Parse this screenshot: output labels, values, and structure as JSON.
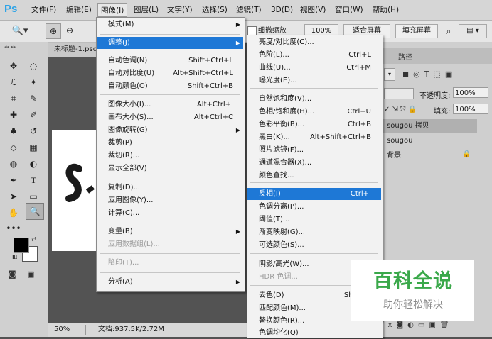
{
  "app": {
    "logo": "Ps"
  },
  "menubar": {
    "items": [
      {
        "label": "文件(F)"
      },
      {
        "label": "编辑(E)"
      },
      {
        "label": "图像(I)"
      },
      {
        "label": "图层(L)"
      },
      {
        "label": "文字(Y)"
      },
      {
        "label": "选择(S)"
      },
      {
        "label": "滤镜(T)"
      },
      {
        "label": "3D(D)"
      },
      {
        "label": "视图(V)"
      },
      {
        "label": "窗口(W)"
      },
      {
        "label": "帮助(H)"
      }
    ]
  },
  "options": {
    "fine_zoom": "细微缩放",
    "zoom_100": "100%",
    "fit_screen": "适合屏幕",
    "fill_screen": "填充屏幕"
  },
  "document": {
    "tab_title": "未标题-1.psd",
    "zoom": "50%",
    "doc_info": "文档:937.5K/2.72M"
  },
  "panels": {
    "tab_path": "路径",
    "opacity_label": "不透明度:",
    "opacity_value": "100%",
    "fill_label": "填充:",
    "fill_value": "100%",
    "layers": [
      "sougou 拷贝",
      "sougou",
      "背景"
    ]
  },
  "image_menu": {
    "items": [
      {
        "label": "模式(M)",
        "shortcut": "",
        "submenu": true
      },
      {
        "label": "调整(J)",
        "shortcut": "",
        "submenu": true,
        "highlighted": true
      },
      {
        "label": "自动色调(N)",
        "shortcut": "Shift+Ctrl+L"
      },
      {
        "label": "自动对比度(U)",
        "shortcut": "Alt+Shift+Ctrl+L"
      },
      {
        "label": "自动颜色(O)",
        "shortcut": "Shift+Ctrl+B"
      },
      {
        "label": "图像大小(I)...",
        "shortcut": "Alt+Ctrl+I"
      },
      {
        "label": "画布大小(S)...",
        "shortcut": "Alt+Ctrl+C"
      },
      {
        "label": "图像旋转(G)",
        "shortcut": "",
        "submenu": true
      },
      {
        "label": "裁剪(P)",
        "shortcut": ""
      },
      {
        "label": "裁切(R)...",
        "shortcut": ""
      },
      {
        "label": "显示全部(V)",
        "shortcut": ""
      },
      {
        "label": "复制(D)...",
        "shortcut": ""
      },
      {
        "label": "应用图像(Y)...",
        "shortcut": ""
      },
      {
        "label": "计算(C)...",
        "shortcut": ""
      },
      {
        "label": "变量(B)",
        "shortcut": "",
        "submenu": true
      },
      {
        "label": "应用数据组(L)...",
        "shortcut": "",
        "disabled": true
      },
      {
        "label": "陷印(T)...",
        "shortcut": "",
        "disabled": true
      },
      {
        "label": "分析(A)",
        "shortcut": "",
        "submenu": true
      }
    ]
  },
  "adjust_menu": {
    "items": [
      {
        "label": "亮度/对比度(C)...",
        "shortcut": ""
      },
      {
        "label": "色阶(L)...",
        "shortcut": "Ctrl+L"
      },
      {
        "label": "曲线(U)...",
        "shortcut": "Ctrl+M"
      },
      {
        "label": "曝光度(E)...",
        "shortcut": ""
      },
      {
        "label": "自然饱和度(V)...",
        "shortcut": ""
      },
      {
        "label": "色相/饱和度(H)...",
        "shortcut": "Ctrl+U"
      },
      {
        "label": "色彩平衡(B)...",
        "shortcut": "Ctrl+B"
      },
      {
        "label": "黑白(K)...",
        "shortcut": "Alt+Shift+Ctrl+B"
      },
      {
        "label": "照片滤镜(F)...",
        "shortcut": ""
      },
      {
        "label": "通道混合器(X)...",
        "shortcut": ""
      },
      {
        "label": "颜色查找...",
        "shortcut": ""
      },
      {
        "label": "反相(I)",
        "shortcut": "Ctrl+I",
        "highlighted": true
      },
      {
        "label": "色调分离(P)...",
        "shortcut": ""
      },
      {
        "label": "阈值(T)...",
        "shortcut": ""
      },
      {
        "label": "渐变映射(G)...",
        "shortcut": ""
      },
      {
        "label": "可选颜色(S)...",
        "shortcut": ""
      },
      {
        "label": "阴影/高光(W)...",
        "shortcut": ""
      },
      {
        "label": "HDR 色调...",
        "shortcut": "",
        "disabled": true
      },
      {
        "label": "去色(D)",
        "shortcut": "Shift+C"
      },
      {
        "label": "匹配颜色(M)...",
        "shortcut": ""
      },
      {
        "label": "替换颜色(R)...",
        "shortcut": ""
      },
      {
        "label": "色调均化(Q)",
        "shortcut": ""
      }
    ]
  },
  "watermark": {
    "title": "百科全说",
    "subtitle": "助你轻松解决"
  },
  "colors": {
    "highlight": "#1e78d6",
    "menubar": "#d6d6d6",
    "workspace": "#535353",
    "logo": "#2fa4e7",
    "watermark_green": "#3aa84a"
  }
}
